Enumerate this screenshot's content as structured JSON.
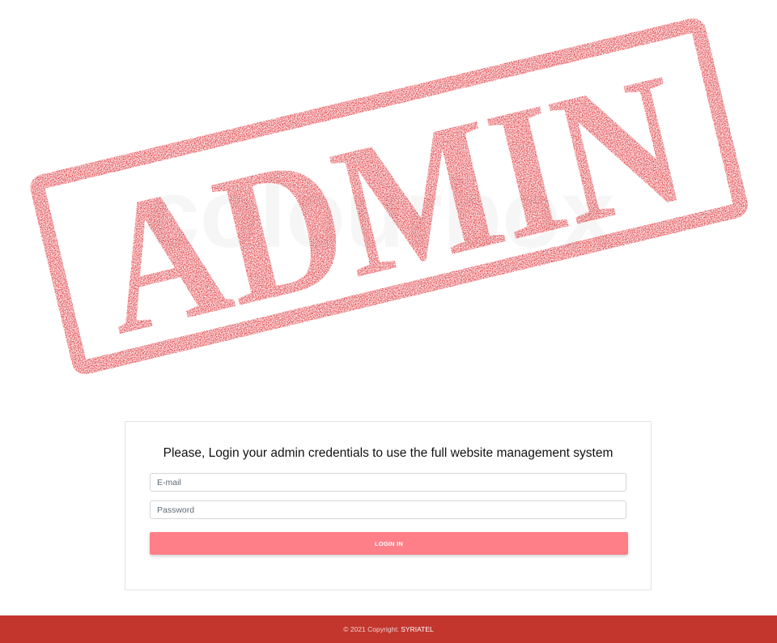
{
  "hero": {
    "stamp_text": "ADMIN",
    "watermark_text": "colourbox",
    "stamp_color": "#d90d12"
  },
  "login": {
    "heading": "Please, Login your admin credentials to use the full website management system",
    "email_placeholder": "E-mail",
    "password_placeholder": "Password",
    "button_label": "LOGIN IN",
    "button_color": "#ff7f89"
  },
  "footer": {
    "copyright_prefix": "© 2021 Copyright:",
    "brand": "SYRIATEL",
    "background_color": "#c2362e"
  }
}
